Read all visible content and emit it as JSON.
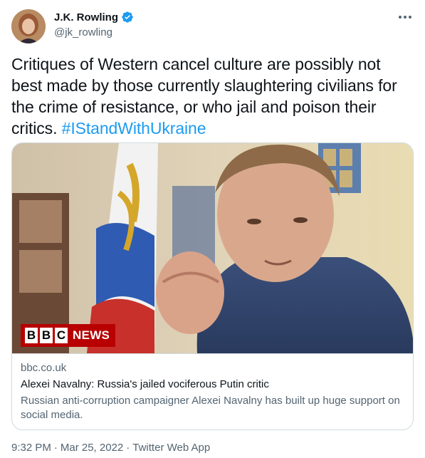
{
  "author": {
    "display_name": "J.K. Rowling",
    "handle": "@jk_rowling",
    "verified": true,
    "avatar_icon": "profile-photo"
  },
  "more_icon": "more-icon",
  "tweet": {
    "text": "Critiques of Western cancel culture are possibly not best made by those currently slaughtering civilians for the crime of resistance, or who jail and poison their critics. ",
    "hashtag": "#IStandWithUkraine"
  },
  "card": {
    "logo_letters": [
      "B",
      "B",
      "C"
    ],
    "logo_text": "NEWS",
    "domain": "bbc.co.uk",
    "title": "Alexei Navalny: Russia's jailed vociferous Putin critic",
    "description": "Russian anti-corruption campaigner Alexei Navalny has built up huge support on social media."
  },
  "meta": {
    "time": "9:32 PM",
    "date": "Mar 25, 2022",
    "source": "Twitter Web App",
    "separator": "·"
  },
  "colors": {
    "link": "#1d9bf0",
    "secondary_text": "#536471",
    "border": "#cfd9de",
    "bbc_red": "#b80000"
  }
}
